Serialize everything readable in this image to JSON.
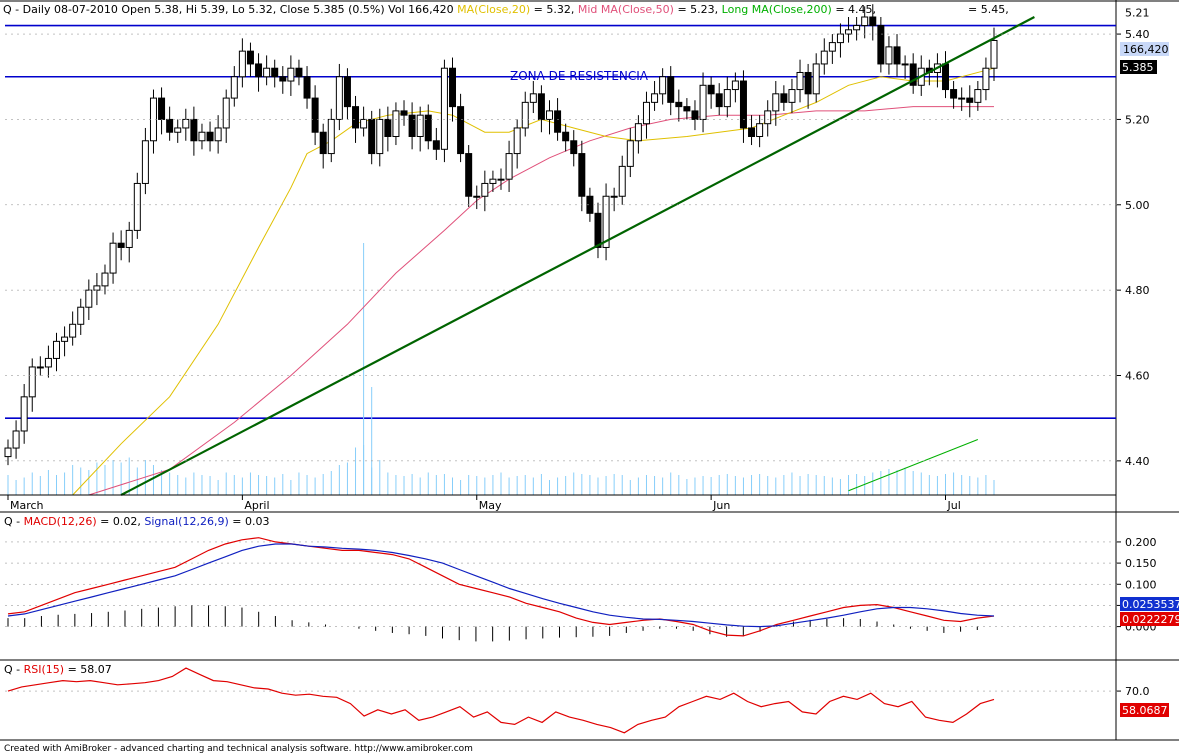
{
  "header": {
    "prefix": "Q - Daily 08-07-2010 Open 5.38, Hi 5.39, Lo 5.32, Close 5.385 (0.5%) Vol 166,420 ",
    "ma20": "MA(Close,20)",
    "ma20_val": " = 5.32, ",
    "ma50": "Mid MA(Close,50)",
    "ma50_val": " = 5.23, ",
    "ma200": "Long MA(Close,200)",
    "ma200_val": " = 4.45,",
    "extra": "= 5.45,"
  },
  "annotation": "ZONA DE RESISTENCIA",
  "footer": "Created with AmiBroker - advanced charting and technical analysis software. http://www.amibroker.com",
  "colors": {
    "ma20": "#e0c000",
    "ma50": "#e0507a",
    "ma200": "#00b000",
    "hline": "#0000cc",
    "trend": "#006400",
    "volume": "#87cefa",
    "macd": "#e00000",
    "signal": "#1020c0",
    "rsi": "#e00000"
  },
  "chart_data": [
    {
      "type": "candlestick",
      "symbol": "Q",
      "period": "Daily",
      "ylim": [
        4.32,
        5.44
      ],
      "y_ticks": [
        4.4,
        4.6,
        4.8,
        5.0,
        5.2,
        5.4
      ],
      "y_tick_labels": [
        "4.40",
        "4.60",
        "4.80",
        "5.00",
        "5.20",
        "5.40"
      ],
      "extra_tick": {
        "value": 5.45,
        "label": "5.21"
      },
      "x_months": [
        {
          "label": "March",
          "index": 0
        },
        {
          "label": "April",
          "index": 29
        },
        {
          "label": "May",
          "index": 58
        },
        {
          "label": "Jun",
          "index": 87
        },
        {
          "label": "Jul",
          "index": 116
        }
      ],
      "last_close_label": "5.385",
      "last_volume_label": "166,420",
      "horizontal_levels": [
        5.42,
        5.3,
        4.5
      ],
      "trendline": {
        "x1": 14,
        "y1": 4.32,
        "x2": 127,
        "y2": 5.44
      },
      "ma200_segment": {
        "x1": 104,
        "y1": 4.33,
        "x2": 120,
        "y2": 4.45
      },
      "closes": [
        4.43,
        4.47,
        4.55,
        4.62,
        4.62,
        4.64,
        4.68,
        4.69,
        4.72,
        4.76,
        4.8,
        4.81,
        4.84,
        4.91,
        4.9,
        4.94,
        5.05,
        5.15,
        5.25,
        5.2,
        5.17,
        5.18,
        5.2,
        5.15,
        5.17,
        5.15,
        5.18,
        5.25,
        5.3,
        5.36,
        5.33,
        5.3,
        5.32,
        5.3,
        5.29,
        5.32,
        5.3,
        5.25,
        5.17,
        5.12,
        5.2,
        5.3,
        5.23,
        5.18,
        5.2,
        5.12,
        5.2,
        5.16,
        5.22,
        5.21,
        5.16,
        5.21,
        5.15,
        5.13,
        5.32,
        5.23,
        5.12,
        5.02,
        5.02,
        5.05,
        5.06,
        5.06,
        5.12,
        5.18,
        5.24,
        5.26,
        5.2,
        5.22,
        5.17,
        5.15,
        5.12,
        5.02,
        4.98,
        4.9,
        5.02,
        5.02,
        5.09,
        5.15,
        5.19,
        5.24,
        5.26,
        5.3,
        5.24,
        5.23,
        5.22,
        5.2,
        5.28,
        5.26,
        5.23,
        5.27,
        5.29,
        5.18,
        5.16,
        5.19,
        5.22,
        5.26,
        5.24,
        5.27,
        5.31,
        5.26,
        5.33,
        5.36,
        5.38,
        5.4,
        5.41,
        5.42,
        5.44,
        5.42,
        5.33,
        5.37,
        5.33,
        5.33,
        5.28,
        5.32,
        5.31,
        5.33,
        5.27,
        5.25,
        5.25,
        5.24,
        5.27,
        5.32,
        5.385
      ],
      "volume": [
        40,
        30,
        35,
        45,
        38,
        50,
        40,
        45,
        60,
        55,
        50,
        65,
        60,
        70,
        65,
        75,
        55,
        70,
        60,
        50,
        45,
        40,
        35,
        45,
        40,
        38,
        30,
        45,
        40,
        35,
        45,
        40,
        38,
        35,
        42,
        30,
        45,
        40,
        35,
        42,
        48,
        60,
        65,
        95,
        100,
        55,
        70,
        45,
        40,
        38,
        42,
        35,
        45,
        40,
        42,
        35,
        30,
        40,
        38,
        35,
        40,
        45,
        35,
        38,
        40,
        35,
        42,
        30,
        35,
        38,
        45,
        42,
        40,
        35,
        38,
        42,
        40,
        30,
        35,
        40,
        38,
        35,
        45,
        40,
        32,
        35,
        38,
        36,
        40,
        42,
        38,
        35,
        40,
        42,
        38,
        35,
        40,
        45,
        38,
        42,
        40,
        38,
        35,
        32,
        40,
        42,
        38,
        45,
        48,
        52,
        50,
        55,
        48,
        45,
        40,
        38,
        42,
        45,
        40,
        38,
        35,
        40,
        30
      ],
      "ma20_path": [
        [
          8,
          4.32
        ],
        [
          14,
          4.44
        ],
        [
          20,
          4.55
        ],
        [
          26,
          4.72
        ],
        [
          31,
          4.9
        ],
        [
          35,
          5.04
        ],
        [
          37,
          5.12
        ],
        [
          40,
          5.15
        ],
        [
          43,
          5.19
        ],
        [
          47,
          5.21
        ],
        [
          52,
          5.22
        ],
        [
          55,
          5.21
        ],
        [
          59,
          5.17
        ],
        [
          62,
          5.17
        ],
        [
          66,
          5.2
        ],
        [
          70,
          5.18
        ],
        [
          74,
          5.16
        ],
        [
          78,
          5.15
        ],
        [
          84,
          5.16
        ],
        [
          88,
          5.17
        ],
        [
          92,
          5.18
        ],
        [
          96,
          5.21
        ],
        [
          100,
          5.24
        ],
        [
          104,
          5.28
        ],
        [
          108,
          5.3
        ],
        [
          112,
          5.29
        ],
        [
          116,
          5.29
        ],
        [
          122,
          5.32
        ]
      ],
      "ma50_path": [
        [
          10,
          4.32
        ],
        [
          20,
          4.38
        ],
        [
          28,
          4.49
        ],
        [
          35,
          4.6
        ],
        [
          42,
          4.72
        ],
        [
          48,
          4.84
        ],
        [
          54,
          4.94
        ],
        [
          58,
          5.01
        ],
        [
          62,
          5.06
        ],
        [
          67,
          5.11
        ],
        [
          72,
          5.15
        ],
        [
          77,
          5.18
        ],
        [
          82,
          5.2
        ],
        [
          88,
          5.21
        ],
        [
          94,
          5.21
        ],
        [
          100,
          5.22
        ],
        [
          106,
          5.22
        ],
        [
          112,
          5.23
        ],
        [
          116,
          5.23
        ],
        [
          122,
          5.23
        ]
      ]
    },
    {
      "type": "line",
      "title": "MACD",
      "legend": "Q - MACD(12,26) = 0.02, Signal(12,26,9) = 0.03",
      "ylim": [
        -0.06,
        0.24
      ],
      "y_ticks": [
        0.0,
        0.05,
        0.1,
        0.15,
        0.2
      ],
      "y_tick_labels": [
        "0.000",
        "0.050",
        "0.100",
        "0.150",
        "0.200"
      ],
      "labels": {
        "signal": "0.0253537",
        "macd": "0.0222279"
      },
      "series": [
        {
          "name": "MACD",
          "values": [
            0.03,
            0.035,
            0.05,
            0.065,
            0.08,
            0.09,
            0.1,
            0.11,
            0.12,
            0.13,
            0.14,
            0.16,
            0.18,
            0.195,
            0.205,
            0.21,
            0.2,
            0.195,
            0.19,
            0.185,
            0.18,
            0.18,
            0.175,
            0.17,
            0.16,
            0.14,
            0.12,
            0.1,
            0.09,
            0.08,
            0.07,
            0.055,
            0.045,
            0.035,
            0.02,
            0.01,
            0.005,
            0.01,
            0.015,
            0.018,
            0.012,
            0.005,
            -0.01,
            -0.02,
            -0.022,
            -0.01,
            0.005,
            0.015,
            0.025,
            0.035,
            0.045,
            0.05,
            0.052,
            0.045,
            0.035,
            0.025,
            0.015,
            0.012,
            0.02,
            0.025
          ]
        },
        {
          "name": "Signal",
          "values": [
            0.025,
            0.03,
            0.04,
            0.05,
            0.06,
            0.07,
            0.08,
            0.09,
            0.1,
            0.11,
            0.12,
            0.135,
            0.15,
            0.165,
            0.18,
            0.19,
            0.195,
            0.195,
            0.19,
            0.188,
            0.185,
            0.183,
            0.18,
            0.175,
            0.168,
            0.16,
            0.15,
            0.135,
            0.12,
            0.105,
            0.09,
            0.078,
            0.066,
            0.055,
            0.045,
            0.035,
            0.027,
            0.022,
            0.018,
            0.017,
            0.015,
            0.012,
            0.008,
            0.004,
            0.001,
            0.0,
            0.002,
            0.008,
            0.014,
            0.02,
            0.027,
            0.035,
            0.042,
            0.045,
            0.045,
            0.042,
            0.037,
            0.031,
            0.027,
            0.025
          ]
        }
      ],
      "histogram": [
        0.02,
        0.02,
        0.025,
        0.028,
        0.03,
        0.032,
        0.035,
        0.038,
        0.042,
        0.045,
        0.048,
        0.05,
        0.05,
        0.048,
        0.045,
        0.035,
        0.025,
        0.015,
        0.01,
        0.005,
        0.0,
        -0.005,
        -0.01,
        -0.015,
        -0.018,
        -0.022,
        -0.028,
        -0.032,
        -0.035,
        -0.035,
        -0.033,
        -0.03,
        -0.028,
        -0.026,
        -0.025,
        -0.024,
        -0.022,
        -0.015,
        -0.01,
        -0.005,
        -0.005,
        -0.01,
        -0.018,
        -0.024,
        -0.023,
        -0.012,
        0.005,
        0.012,
        0.016,
        0.018,
        0.02,
        0.018,
        0.012,
        0.005,
        -0.005,
        -0.01,
        -0.015,
        -0.012,
        -0.008,
        0.0
      ]
    },
    {
      "type": "line",
      "title": "RSI",
      "legend": "Q - RSI(15) = 58.07",
      "ylim": [
        25,
        95
      ],
      "y_ticks": [
        70
      ],
      "y_tick_labels": [
        "70.0"
      ],
      "value_label": "58.0687",
      "series": [
        {
          "name": "RSI",
          "values": [
            70,
            74,
            76,
            78,
            80,
            79,
            80,
            78,
            76,
            77,
            78,
            80,
            84,
            92,
            86,
            80,
            79,
            76,
            73,
            72,
            68,
            66,
            67,
            65,
            64,
            58,
            46,
            52,
            48,
            52,
            42,
            45,
            50,
            55,
            45,
            50,
            40,
            38,
            45,
            40,
            50,
            45,
            42,
            38,
            35,
            30,
            38,
            42,
            45,
            55,
            60,
            65,
            62,
            68,
            60,
            55,
            58,
            60,
            50,
            48,
            60,
            65,
            62,
            68,
            58,
            55,
            60,
            45,
            42,
            40,
            48,
            58,
            62
          ]
        }
      ]
    }
  ]
}
